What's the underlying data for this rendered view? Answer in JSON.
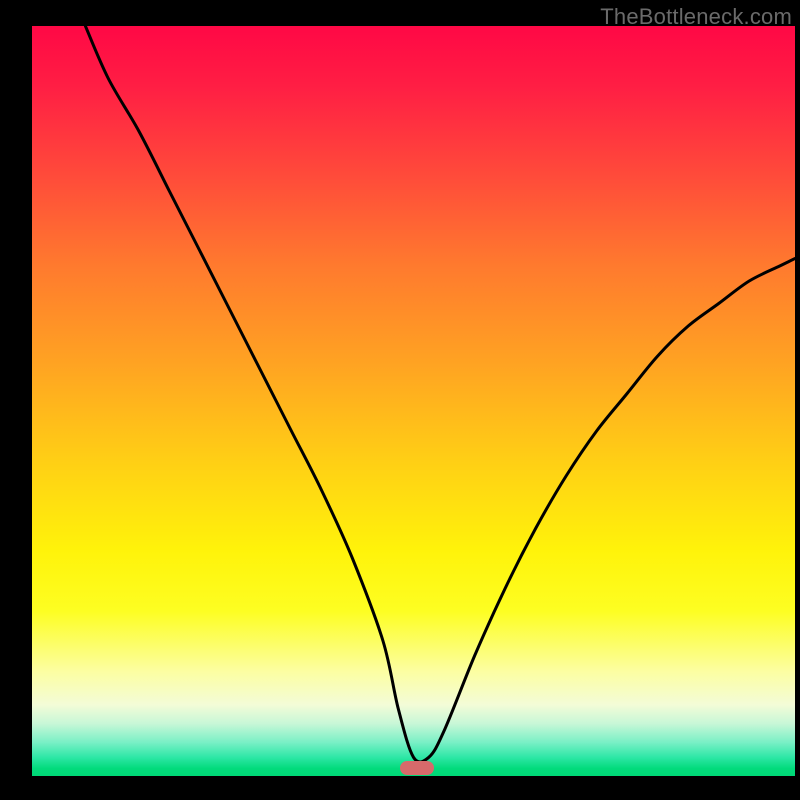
{
  "watermark": "TheBottleneck.com",
  "indicator": {
    "x_percent": 50.5,
    "color": "#d76a6b"
  },
  "chart_data": {
    "type": "line",
    "title": "",
    "xlabel": "",
    "ylabel": "",
    "xlim": [
      0,
      100
    ],
    "ylim": [
      0,
      100
    ],
    "grid": false,
    "legend": false,
    "series": [
      {
        "name": "bottleneck-curve",
        "x": [
          7,
          10,
          14,
          18,
          22,
          26,
          30,
          34,
          38,
          42,
          46,
          48,
          50,
          52,
          54,
          58,
          62,
          66,
          70,
          74,
          78,
          82,
          86,
          90,
          94,
          98,
          100
        ],
        "y": [
          100,
          93,
          86,
          78,
          70,
          62,
          54,
          46,
          38,
          29,
          18,
          9,
          2.5,
          2.5,
          6,
          16,
          25,
          33,
          40,
          46,
          51,
          56,
          60,
          63,
          66,
          68,
          69
        ]
      }
    ],
    "background_gradient": {
      "direction": "vertical",
      "stops": [
        {
          "pos": 0.0,
          "color": "#ff0845"
        },
        {
          "pos": 0.08,
          "color": "#ff1e44"
        },
        {
          "pos": 0.2,
          "color": "#ff4b3a"
        },
        {
          "pos": 0.32,
          "color": "#ff7a2e"
        },
        {
          "pos": 0.45,
          "color": "#ffa322"
        },
        {
          "pos": 0.58,
          "color": "#ffcf15"
        },
        {
          "pos": 0.7,
          "color": "#fff30a"
        },
        {
          "pos": 0.78,
          "color": "#fdfe22"
        },
        {
          "pos": 0.86,
          "color": "#fcfea1"
        },
        {
          "pos": 0.905,
          "color": "#f3fcd7"
        },
        {
          "pos": 0.93,
          "color": "#c8f7d7"
        },
        {
          "pos": 0.955,
          "color": "#7af0c6"
        },
        {
          "pos": 0.975,
          "color": "#2ee7a6"
        },
        {
          "pos": 0.99,
          "color": "#02db7c"
        },
        {
          "pos": 1.0,
          "color": "#00d877"
        }
      ]
    }
  }
}
